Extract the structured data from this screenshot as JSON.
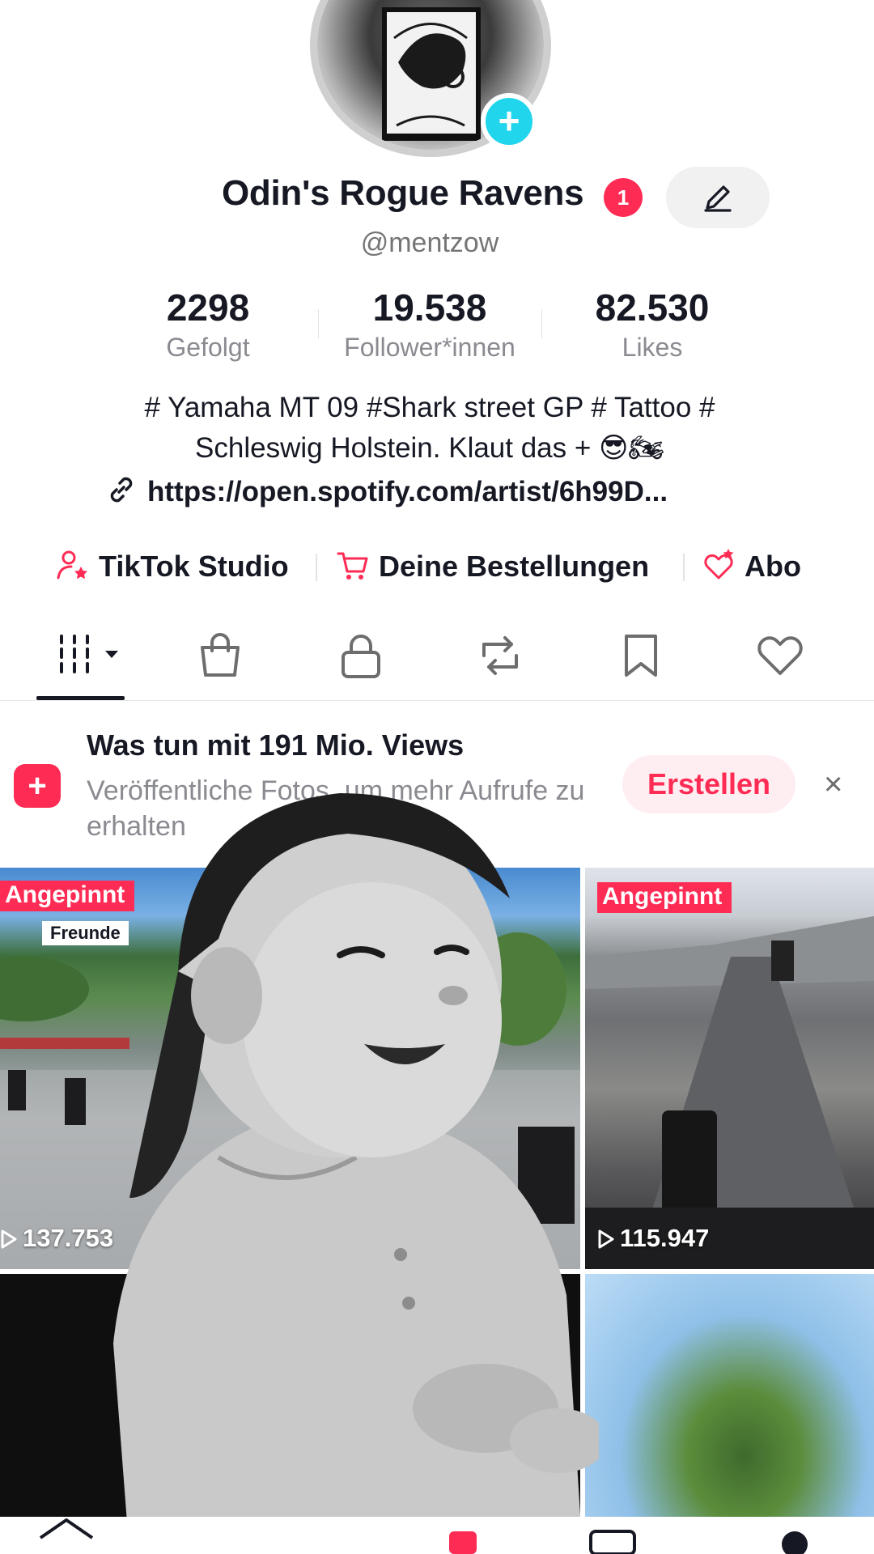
{
  "profile": {
    "display_name": "Odin's Rogue Ravens",
    "notification_count": "1",
    "username": "@mentzow"
  },
  "stats": [
    {
      "value": "2298",
      "label": "Gefolgt"
    },
    {
      "value": "19.538",
      "label": "Follower*innen"
    },
    {
      "value": "82.530",
      "label": "Likes"
    }
  ],
  "bio": {
    "line1": "# Yamaha MT 09 #Shark street GP # Tattoo #",
    "line2": "Schleswig Holstein. Klaut das + 😎🏍",
    "link": "https://open.spotify.com/artist/6h99D..."
  },
  "actions": [
    {
      "label": "TikTok Studio",
      "icon": "person-star-icon"
    },
    {
      "label": "Deine Bestellungen",
      "icon": "cart-icon"
    },
    {
      "label": "Abo",
      "icon": "heart-star-icon"
    }
  ],
  "tabs": [
    "videos-grid-icon",
    "shop-bag-icon",
    "lock-icon",
    "repost-icon",
    "bookmark-icon",
    "heart-icon"
  ],
  "promo": {
    "title": "Was tun mit 191 Mio. Views",
    "text": "Veröffentliche Fotos, um mehr Aufrufe zu erhalten",
    "button": "Erstellen",
    "close": "×"
  },
  "videos": [
    {
      "pinned_label": "Angepinnt",
      "tag": "Freunde",
      "views": "137.753"
    },
    {
      "pinned_label": "Angepinnt",
      "views": "115.947"
    }
  ],
  "colors": {
    "accent": "#fe2c55",
    "avatar_plus": "#20d5ec",
    "text": "#161823",
    "secondary_text": "#8a8b91"
  }
}
